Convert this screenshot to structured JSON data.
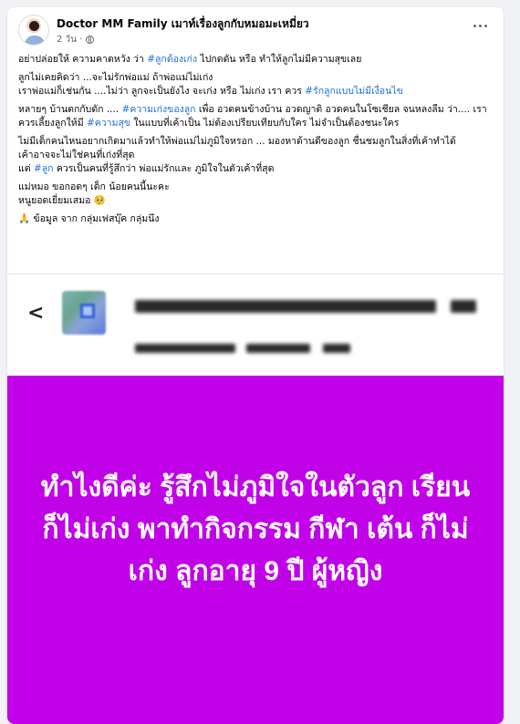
{
  "post": {
    "page_name": "Doctor MM Family เมาท์เรื่องลูกกับหมอมะเหมี่ยว",
    "time": "2 วัน ·",
    "paragraphs": {
      "p1": {
        "a": "อย่าปล่อยให้ ความคาดหวัง ว่า ",
        "tag1": "#ลูกต้องเก่ง",
        "b": "  ไปกดดัน หรือ ทำให้ลูกไม่มีความสุขเลย"
      },
      "p2": {
        "line1": "ลูกไม่เคยคิดว่า ...จะไม่รักพ่อแม่ ถ้าพ่อแม่ไม่เก่ง",
        "a": "เราพ่อแม่ก็เช่นกัน ....ไม่ว่า ลูกจะเป็นยังไง จะเก่ง หรือ ไม่เก่ง เรา ควร ",
        "tag1": "#รักลูกแบบไม่มีเงื่อนไข"
      },
      "p3": {
        "a": "หลายๆ บ้านตกกับดัก .... ",
        "tag1": "#ความเก่งของลูก",
        "b": "  เพื่อ อวดคนข้างบ้าน อวดญาติ อวดคนในโซเชียล จนหลงลืม ว่า.... เราควรเลี้ยงลูกให้มี ",
        "tag2": "#ความสุข",
        "c": " ในแบบที่เค้าเป็น ไม่ต้องเปรียบเทียบกับใคร  ไม่จำเป็นต้องชนะใคร"
      },
      "p4": {
        "line1": "ไม่มีเด็กคนไหนอยากเกิดมาแล้วทำให้พ่อแม่ไม่ภูมิใจหรอก ... มองหาด้านดีของลูก ชื่นชมลูกในสิ่งที่เค้าทำได้",
        "line2": "เค้าอาจจะไม่ใช่คนที่เก่งที่สุด",
        "a": "แต่ ",
        "tag1": "#ลูก",
        "b": " ควรเป็นคนที่รู้สึกว่า พ่อแม่รักและ ภูมิใจในตัวเค้าที่สุด"
      },
      "p5": {
        "line1": "แม่หมอ ขอกอดๆ เด็ก น้อยคนนี้นะคะ",
        "line2": "หนูยอดเยี่ยมเสมอ 🥺"
      },
      "p6": {
        "line1": "🙏 ข้อมูล จาก กลุ่มเฟสบุ๊ค กลุ่มนึง"
      }
    }
  },
  "shared_header": {
    "back_glyph": "<"
  },
  "image": {
    "background": "#c101e8",
    "text": "ทำไงดีค่ะ รู้สึกไม่ภูมิใจในตัวลูก เรียนก็ไม่เก่ง พาทำกิจกรรม กีฬา เต้น ก็ไม่เก่ง ลูกอายุ 9 ปี ผู้หญิง"
  },
  "colors": {
    "hashtag": "#216fdb",
    "secondary_text": "#65676b",
    "image_bg": "#c101e8"
  }
}
